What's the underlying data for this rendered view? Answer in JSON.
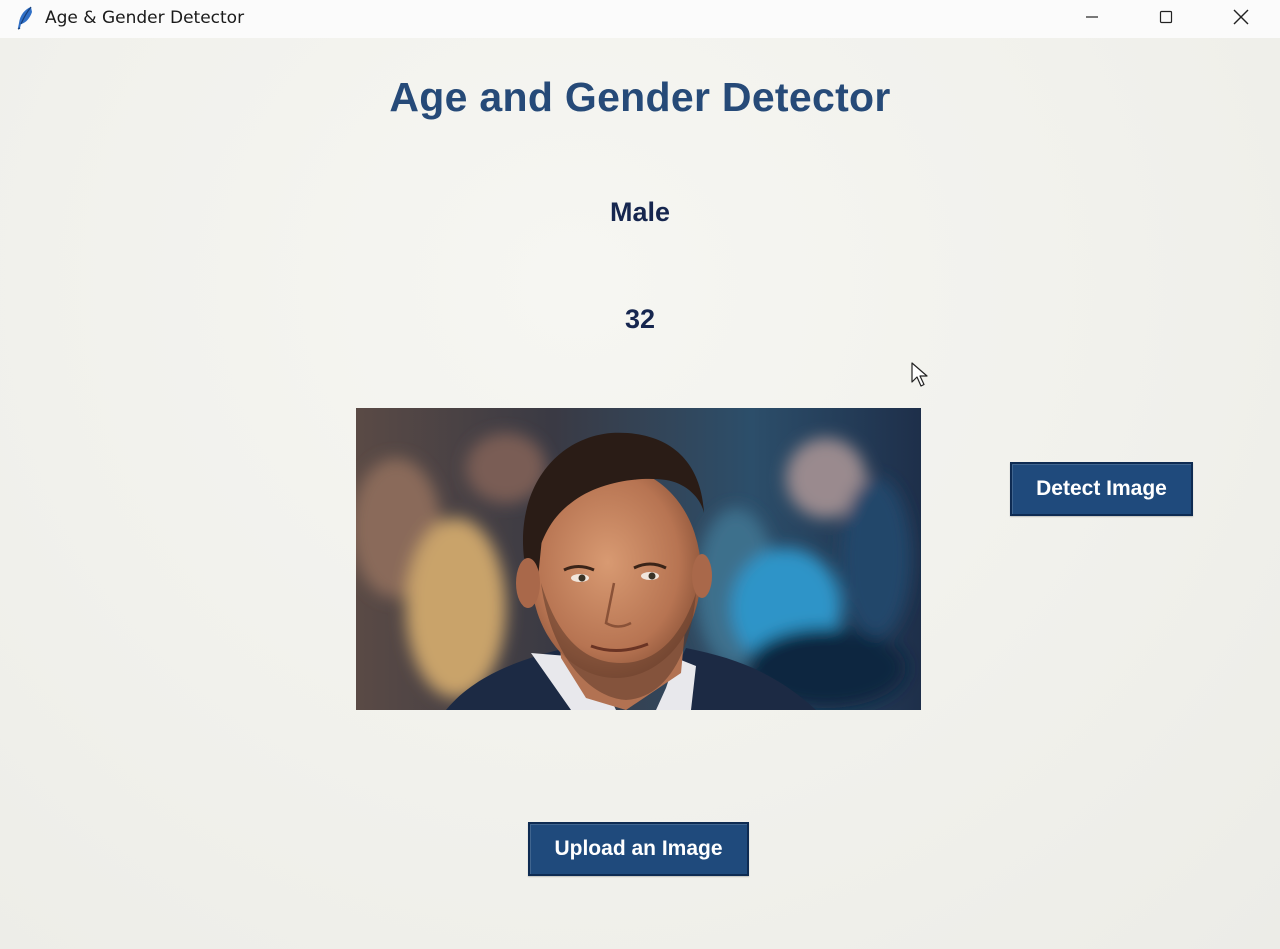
{
  "window": {
    "title": "Age & Gender Detector",
    "icon": "feather-icon",
    "controls": [
      "minimize-icon",
      "maximize-icon",
      "close-icon"
    ]
  },
  "main": {
    "heading": "Age and Gender Detector",
    "gender_result": "Male",
    "age_result": "32",
    "photo_icon": "uploaded-face-photo"
  },
  "buttons": {
    "detect_label": "Detect Image",
    "upload_label": "Upload an Image"
  },
  "colors": {
    "heading": "#264a78",
    "result_text": "#16264f",
    "button_bg": "#1f4a7c",
    "button_text": "#ffffff",
    "background": "#f3f3f0"
  }
}
